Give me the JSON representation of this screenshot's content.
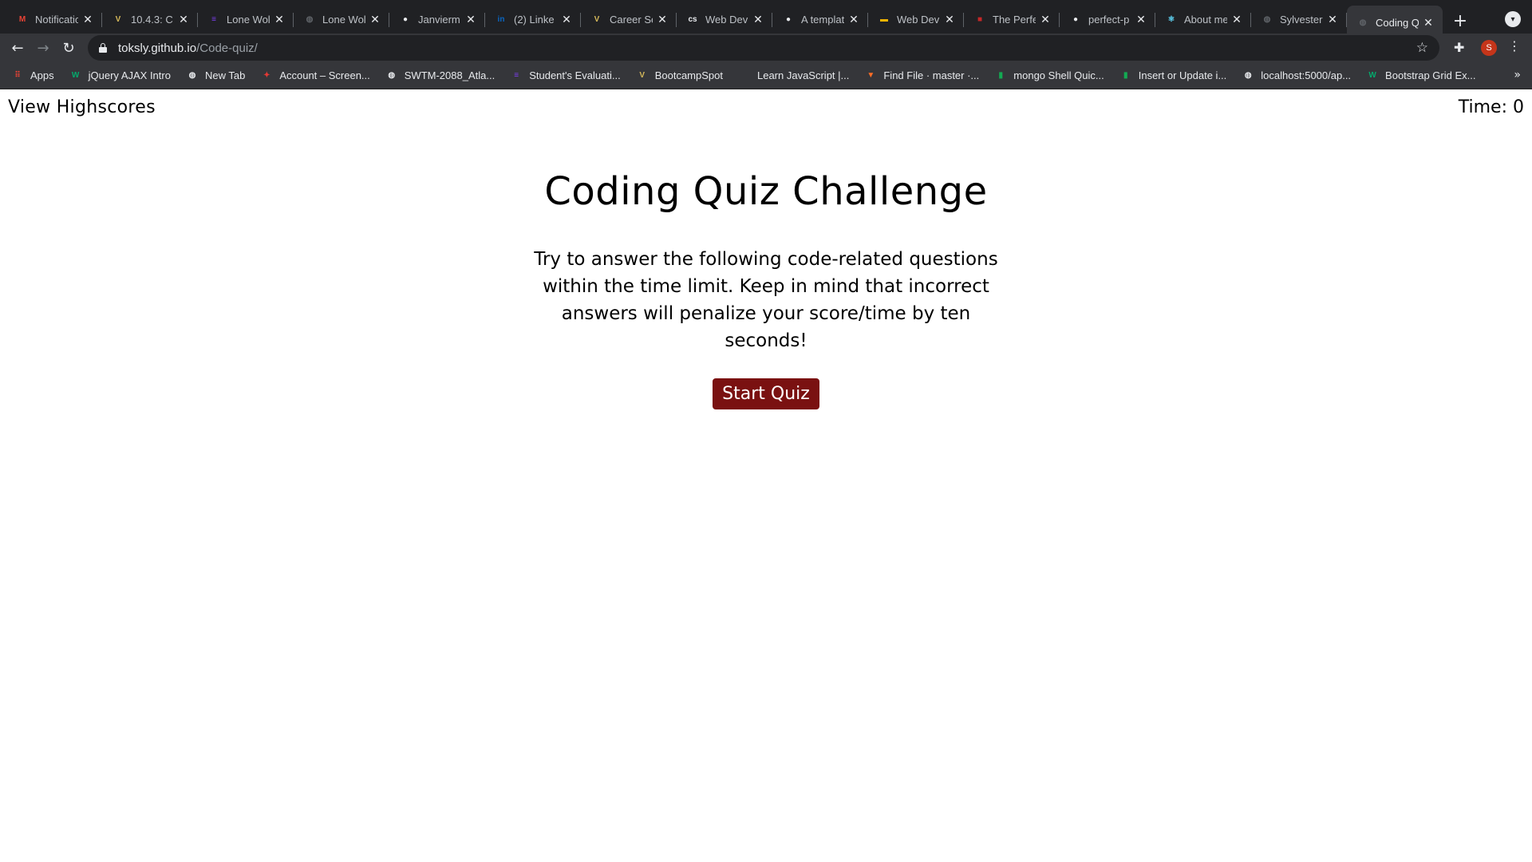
{
  "browser": {
    "tabs": [
      {
        "title": "Notificatio",
        "favicon": "gmail-icon",
        "favicon_color": "#ea4335",
        "favicon_glyph": "M",
        "active": false
      },
      {
        "title": "10.4.3: C",
        "favicon": "vanderbilt-icon",
        "favicon_color": "#d4b85a",
        "favicon_glyph": "V",
        "active": false
      },
      {
        "title": "Lone Wol",
        "favicon": "purple-list-icon",
        "favicon_color": "#7e3ff2",
        "favicon_glyph": "≡",
        "active": false
      },
      {
        "title": "Lone Wol",
        "favicon": "globe-icon",
        "favicon_color": "#5f6368",
        "favicon_glyph": "◍",
        "active": false
      },
      {
        "title": "Janvierm",
        "favicon": "github-icon",
        "favicon_color": "#e8eaed",
        "favicon_glyph": "●",
        "active": false
      },
      {
        "title": "(2) Linke",
        "favicon": "linkedin-icon",
        "favicon_color": "#0a66c2",
        "favicon_glyph": "in",
        "active": false
      },
      {
        "title": "Career Se",
        "favicon": "vanderbilt-icon",
        "favicon_color": "#d4b85a",
        "favicon_glyph": "V",
        "active": false
      },
      {
        "title": "Web Dev",
        "favicon": "cs-icon",
        "favicon_color": "#e8eaed",
        "favicon_glyph": "cs",
        "active": false
      },
      {
        "title": "A templat",
        "favicon": "github-icon",
        "favicon_color": "#e8eaed",
        "favicon_glyph": "●",
        "active": false
      },
      {
        "title": "Web Dev",
        "favicon": "slides-icon",
        "favicon_color": "#f4b400",
        "favicon_glyph": "▬",
        "active": false
      },
      {
        "title": "The Perfe",
        "favicon": "red-icon",
        "favicon_color": "#c62828",
        "favicon_glyph": "■",
        "active": false
      },
      {
        "title": "perfect-p",
        "favicon": "github-icon",
        "favicon_color": "#e8eaed",
        "favicon_glyph": "●",
        "active": false
      },
      {
        "title": "About me",
        "favicon": "react-icon",
        "favicon_color": "#61dafb",
        "favicon_glyph": "⚛",
        "active": false
      },
      {
        "title": "Sylvester",
        "favicon": "globe-icon",
        "favicon_color": "#5f6368",
        "favicon_glyph": "◍",
        "active": false
      },
      {
        "title": "Coding Q",
        "favicon": "globe-icon",
        "favicon_color": "#5f6368",
        "favicon_glyph": "◍",
        "active": true
      }
    ],
    "url_host": "toksly.github.io",
    "url_path": "/Code-quiz/",
    "profile_initial": "S",
    "profile_color": "#c5351a",
    "bookmarks": [
      {
        "label": "Apps",
        "icon": "apps-grid-icon",
        "color": "#ea4335",
        "glyph": "⠿"
      },
      {
        "label": "jQuery AJAX Intro",
        "icon": "w3-icon",
        "color": "#04aa6d",
        "glyph": "W"
      },
      {
        "label": "New Tab",
        "icon": "globe-icon",
        "color": "#e8eaed",
        "glyph": "◍"
      },
      {
        "label": "Account – Screen...",
        "icon": "screencast-icon",
        "color": "#e53935",
        "glyph": "✦"
      },
      {
        "label": "SWTM-2088_Atla...",
        "icon": "globe-icon",
        "color": "#e8eaed",
        "glyph": "◍"
      },
      {
        "label": "Student's Evaluati...",
        "icon": "purple-list-icon",
        "color": "#7e3ff2",
        "glyph": "≡"
      },
      {
        "label": "BootcampSpot",
        "icon": "vanderbilt-icon",
        "color": "#d4b85a",
        "glyph": "V"
      },
      {
        "label": "Learn JavaScript |...",
        "icon": "js-icon",
        "color": "#35363a",
        "glyph": ""
      },
      {
        "label": "Find File · master ·...",
        "icon": "gitlab-icon",
        "color": "#fc6d26",
        "glyph": "▼"
      },
      {
        "label": "mongo Shell Quic...",
        "icon": "mongo-leaf-icon",
        "color": "#13aa52",
        "glyph": "▮"
      },
      {
        "label": "Insert or Update i...",
        "icon": "mongo-leaf-icon",
        "color": "#13aa52",
        "glyph": "▮"
      },
      {
        "label": "localhost:5000/ap...",
        "icon": "globe-icon",
        "color": "#e8eaed",
        "glyph": "◍"
      },
      {
        "label": "Bootstrap Grid Ex...",
        "icon": "w3-icon",
        "color": "#04aa6d",
        "glyph": "W"
      }
    ]
  },
  "page": {
    "highscores_link": "View Highscores",
    "timer": "Time: 0",
    "title": "Coding Quiz Challenge",
    "description": "Try to answer the following code-related questions within the time limit. Keep in mind that incorrect answers will penalize your score/time by ten seconds!",
    "start_button": "Start Quiz",
    "start_button_color": "#7a1111"
  }
}
